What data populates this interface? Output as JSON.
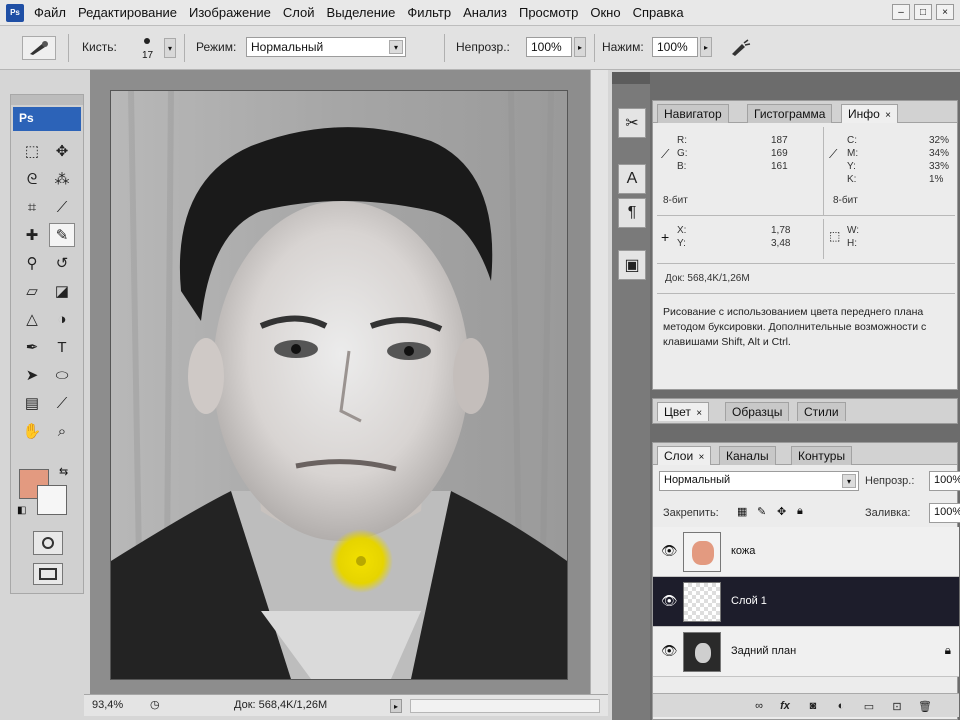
{
  "app": {
    "badge": "Ps"
  },
  "menu": [
    "Файл",
    "Редактирование",
    "Изображение",
    "Слой",
    "Выделение",
    "Фильтр",
    "Анализ",
    "Просмотр",
    "Окно",
    "Справка"
  ],
  "window_controls": [
    "–",
    "□",
    "×"
  ],
  "options": {
    "brush_label": "Кисть:",
    "brush_size": "17",
    "mode_label": "Режим:",
    "mode_value": "Нормальный",
    "opacity_label": "Непрозр.:",
    "opacity_value": "100%",
    "flow_label": "Нажим:",
    "flow_value": "100%"
  },
  "toolbox": {
    "logo": "Ps",
    "tools": [
      {
        "name": "marquee-tool",
        "glyph": "⬚"
      },
      {
        "name": "move-tool",
        "glyph": "✥"
      },
      {
        "name": "lasso-tool",
        "glyph": "ᘓ"
      },
      {
        "name": "magic-wand-tool",
        "glyph": "⁂"
      },
      {
        "name": "crop-tool",
        "glyph": "⌗"
      },
      {
        "name": "slice-tool",
        "glyph": "⟋"
      },
      {
        "name": "healing-brush-tool",
        "glyph": "✚"
      },
      {
        "name": "brush-tool",
        "glyph": "✎"
      },
      {
        "name": "clone-stamp-tool",
        "glyph": "⚲"
      },
      {
        "name": "history-brush-tool",
        "glyph": "↺"
      },
      {
        "name": "eraser-tool",
        "glyph": "▱"
      },
      {
        "name": "paint-bucket-tool",
        "glyph": "◪"
      },
      {
        "name": "blur-tool",
        "glyph": "△"
      },
      {
        "name": "dodge-tool",
        "glyph": "◑"
      },
      {
        "name": "pen-tool",
        "glyph": "✒"
      },
      {
        "name": "type-tool",
        "glyph": "T"
      },
      {
        "name": "path-selection-tool",
        "glyph": "➤"
      },
      {
        "name": "shape-tool",
        "glyph": "⬭"
      },
      {
        "name": "notes-tool",
        "glyph": "▤"
      },
      {
        "name": "eyedropper-tool",
        "glyph": "⟋"
      },
      {
        "name": "hand-tool",
        "glyph": "✋"
      },
      {
        "name": "zoom-tool",
        "glyph": "⌕"
      }
    ],
    "active_tool": "brush-tool",
    "fg_color": "#e39a80",
    "bg_color": "#f6f6f6"
  },
  "status": {
    "zoom": "93,4%",
    "doc": "Док: 568,4K/1,26M"
  },
  "dock": [
    "tools-icon",
    "type-icon",
    "paragraph-icon",
    "image-icon"
  ],
  "info_panel": {
    "tabs": [
      "Навигатор",
      "Гистограмма",
      "Инфо"
    ],
    "active_tab": "Инфо",
    "rgb": [
      {
        "l": "R:",
        "v": "187"
      },
      {
        "l": "G:",
        "v": "169"
      },
      {
        "l": "B:",
        "v": "161"
      }
    ],
    "cmyk": [
      {
        "l": "C:",
        "v": "32%"
      },
      {
        "l": "M:",
        "v": "34%"
      },
      {
        "l": "Y:",
        "v": "33%"
      },
      {
        "l": "K:",
        "v": "1%"
      }
    ],
    "bit_left": "8-бит",
    "bit_right": "8-бит",
    "xy": [
      {
        "l": "X:",
        "v": "1,78"
      },
      {
        "l": "Y:",
        "v": "3,48"
      }
    ],
    "wh": [
      {
        "l": "W:",
        "v": ""
      },
      {
        "l": "H:",
        "v": ""
      }
    ],
    "doc": "Док: 568,4K/1,26M",
    "help": "Рисование с использованием цвета переднего плана методом буксировки. Дополнительные возможности с клавишами Shift, Alt и Ctrl."
  },
  "color_panel": {
    "tabs": [
      "Цвет",
      "Образцы",
      "Стили"
    ],
    "active_tab": "Цвет"
  },
  "layers_panel": {
    "tabs": [
      "Слои",
      "Каналы",
      "Контуры"
    ],
    "active_tab": "Слои",
    "blend_mode": "Нормальный",
    "opacity_label": "Непрозр.:",
    "opacity_value": "100%",
    "lock_label": "Закрепить:",
    "fill_label": "Заливка:",
    "fill_value": "100%",
    "layers": [
      {
        "name": "кожа",
        "selected": false,
        "lock": false
      },
      {
        "name": "Слой 1",
        "selected": true,
        "lock": false
      },
      {
        "name": "Задний план",
        "selected": false,
        "lock": true
      }
    ],
    "footer_icons": [
      "link-icon",
      "fx-icon",
      "mask-icon",
      "adjustment-icon",
      "group-icon",
      "new-layer-icon",
      "trash-icon"
    ]
  }
}
